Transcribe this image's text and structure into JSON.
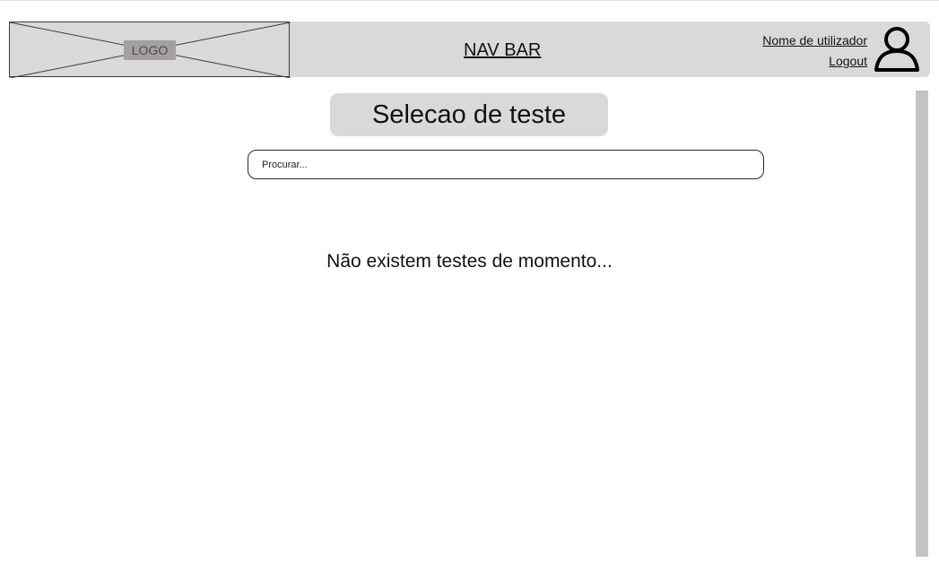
{
  "navbar": {
    "logo_label": "LOGO",
    "title": "NAV BAR",
    "username": "Nome de utilizador",
    "logout_label": "Logout",
    "user_icon": "user-icon"
  },
  "main": {
    "title": "Selecao de teste",
    "search": {
      "placeholder": "Procurar...",
      "value": ""
    },
    "empty_message": "Não existem testes de momento..."
  },
  "colors": {
    "navbar_bg": "#d9d9d9",
    "logo_label_bg": "#a49fa0",
    "title_pill_bg": "#d9d9d9",
    "scrollbar": "#c4c2c3"
  }
}
